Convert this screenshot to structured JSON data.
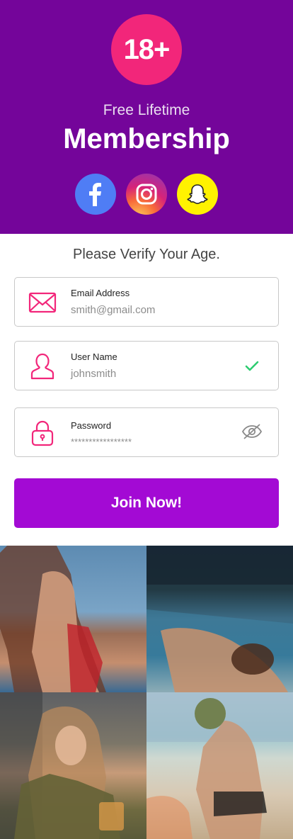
{
  "hero": {
    "badge": "18+",
    "subtitle": "Free Lifetime",
    "title": "Membership",
    "background": "#74059a",
    "badge_color": "#f2267a",
    "social": [
      {
        "icon": "facebook-icon",
        "color": "#4f7df5"
      },
      {
        "icon": "instagram-icon",
        "color": "#d6237a"
      },
      {
        "icon": "snapchat-icon",
        "color": "#fff200"
      }
    ]
  },
  "form": {
    "heading": "Please Verify Your Age.",
    "email": {
      "label": "Email Address",
      "value": "smith@gmail.com",
      "icon": "envelope-icon"
    },
    "username": {
      "label": "User Name",
      "value": "johnsmith",
      "icon": "user-icon",
      "status_icon": "checkmark-icon"
    },
    "password": {
      "label": "Password",
      "value": "*****************",
      "icon": "lock-icon",
      "toggle_icon": "eye-slash-icon"
    },
    "accent": "#f2267a",
    "submit_label": "Join Now!",
    "submit_color": "#a30ad4"
  },
  "gallery": {
    "photos": [
      {
        "icon": "photo-1"
      },
      {
        "icon": "photo-2"
      },
      {
        "icon": "photo-3"
      },
      {
        "icon": "photo-4"
      }
    ]
  }
}
